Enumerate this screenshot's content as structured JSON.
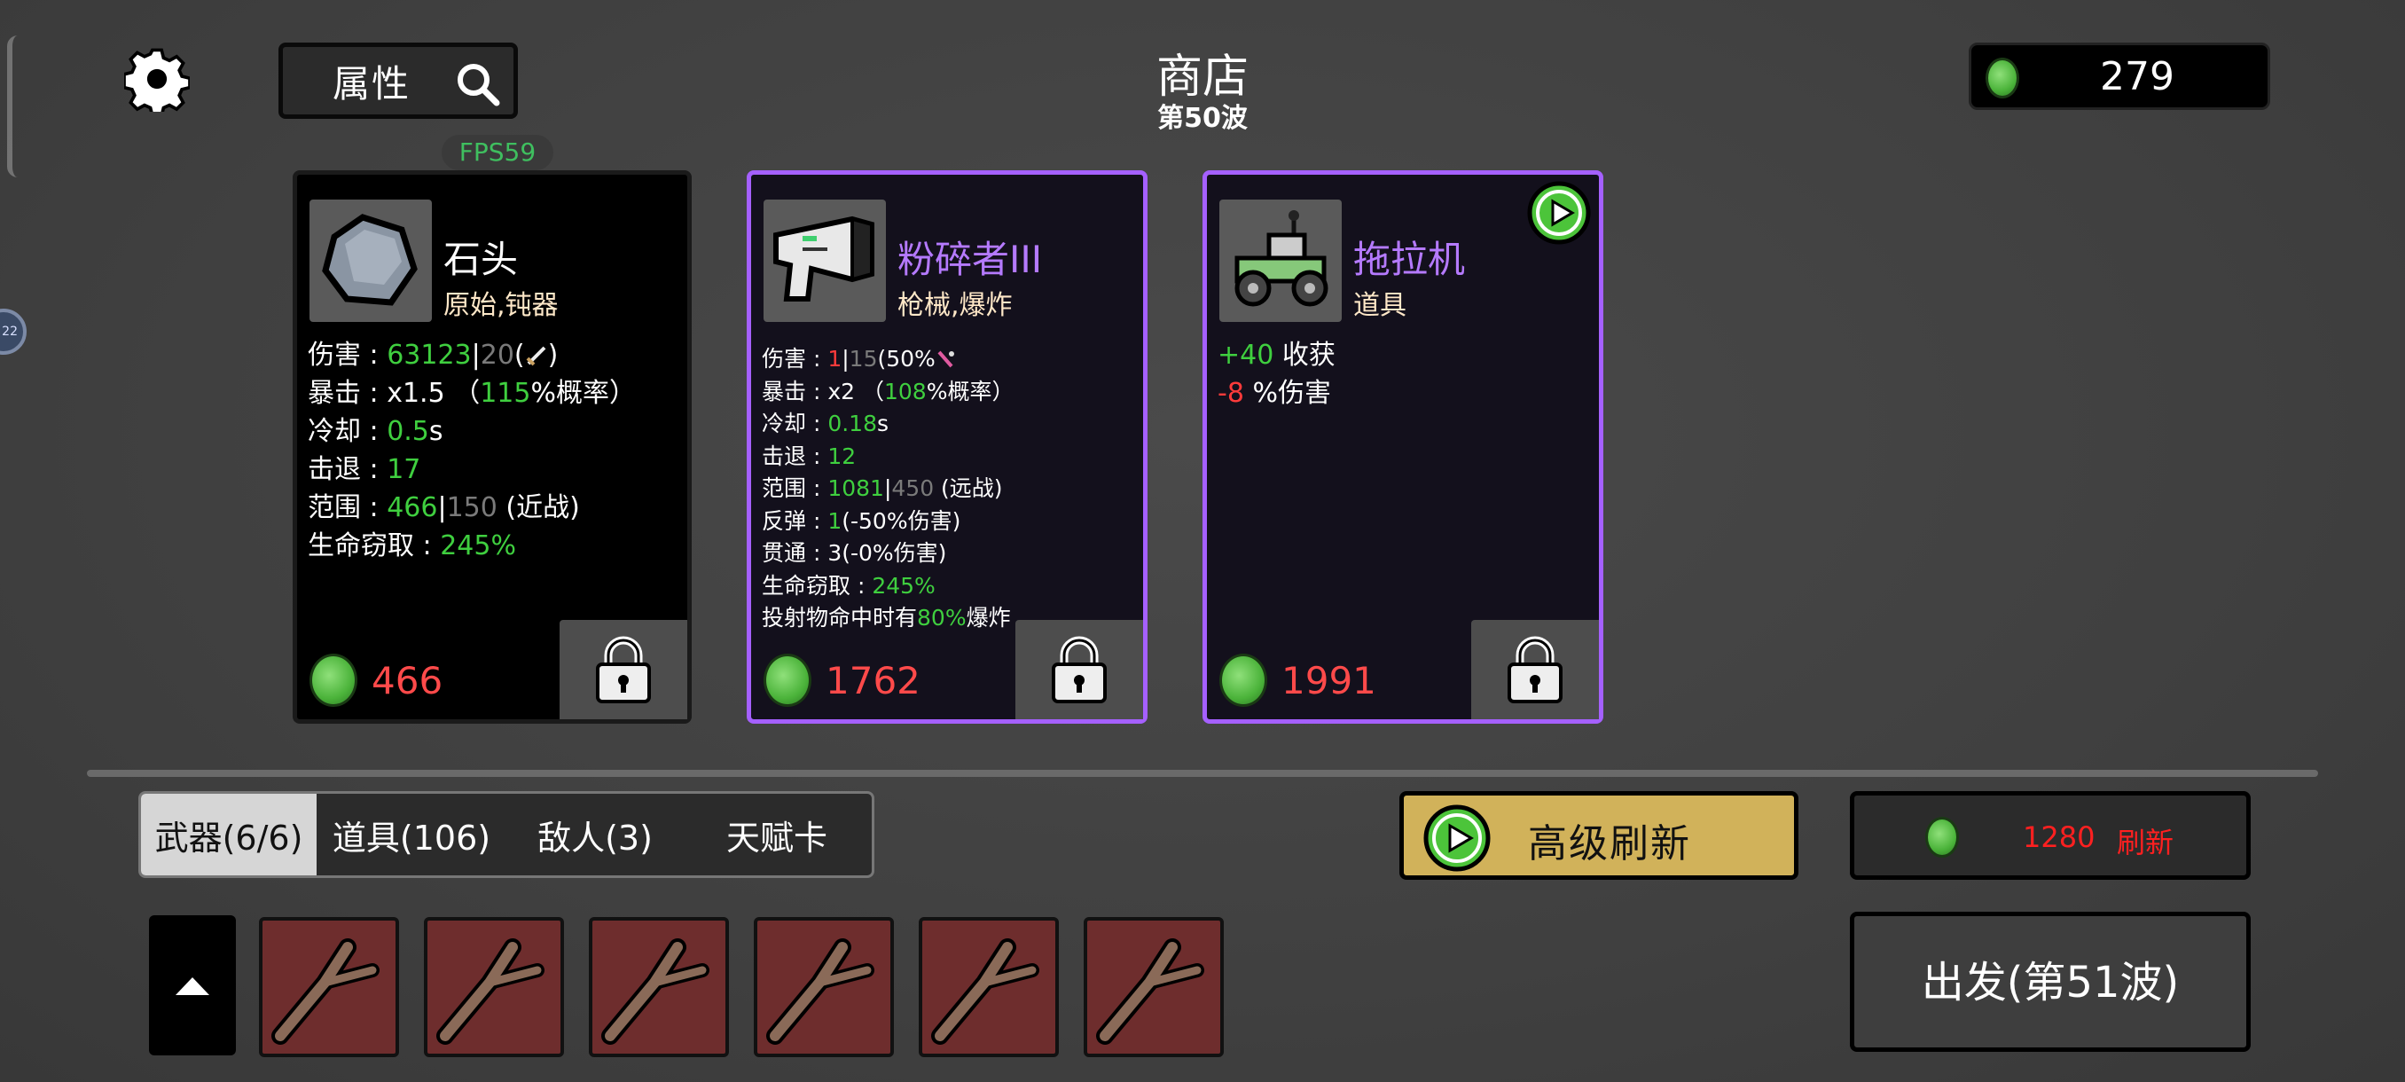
{
  "header": {
    "shop_title": "商店",
    "wave_label": "第50波",
    "attributes_label": "属性",
    "fps": "FPS59",
    "coins": "279",
    "edge_badge": "22"
  },
  "shop": [
    {
      "name": "石头",
      "tags": "原始,钝器",
      "price": "466",
      "icon": "rock-icon",
      "name_color": "#ffffff",
      "stats": {
        "damage_label": "伤害 : ",
        "damage": "63123",
        "damage_sep": "|",
        "damage_base": "20",
        "damage_open": "(",
        "damage_close": ")",
        "crit_label": "暴击 : ",
        "crit_mult": " x1.5 （",
        "crit_chance": "115",
        "crit_unit": "%概率）",
        "cooldown_label": "冷却 : ",
        "cooldown": "0.5",
        "cooldown_unit": "s",
        "knockback_label": "击退 : ",
        "knockback": "17",
        "range_label": "范围 : ",
        "range": "466",
        "range_sep": "|",
        "range_base": "150",
        "range_type": " (近战)",
        "lifesteal_label": "生命窃取 : ",
        "lifesteal": "245%"
      }
    },
    {
      "name": "粉碎者III",
      "tags": "枪械,爆炸",
      "price": "1762",
      "icon": "blaster-gun-icon",
      "name_color": "#b57aff",
      "stats": {
        "damage_label": "伤害 : ",
        "damage": "1",
        "damage_sep": "|",
        "damage_base": "15",
        "damage_extra": "(50%",
        "crit_label": "暴击 : ",
        "crit_mult": " x2 （",
        "crit_chance": "108",
        "crit_unit": "%概率）",
        "cooldown_label": "冷却 : ",
        "cooldown": "0.18",
        "cooldown_unit": "s",
        "knockback_label": "击退 : ",
        "knockback": "12",
        "range_label": "范围 : ",
        "range": "1081",
        "range_sep": "|",
        "range_base": "450",
        "range_type": " (远战)",
        "bounce_label": "反弹 : ",
        "bounce": "1",
        "bounce_unit": "(-50%伤害)",
        "pierce_label": "贯通 : ",
        "pierce": "3(-0%伤害)",
        "lifesteal_label": "生命窃取 : ",
        "lifesteal": "245%",
        "explode_pre": "投射物命中时有",
        "explode_pct": "80%",
        "explode_post": "爆炸"
      }
    },
    {
      "name": "拖拉机",
      "tags": "道具",
      "price": "1991",
      "icon": "tractor-icon",
      "name_color": "#b57aff",
      "stats": {
        "harvest_value": "+40",
        "harvest_label": " 收获",
        "damage_value": "-8",
        "damage_label": " %伤害"
      }
    }
  ],
  "tabs": [
    {
      "label": "武器(6/6)",
      "active": true
    },
    {
      "label": "道具(106)",
      "active": false
    },
    {
      "label": "敌人(3)",
      "active": false
    },
    {
      "label": "天赋卡",
      "active": false
    }
  ],
  "advanced_refresh_label": "高级刷新",
  "refresh": {
    "cost": "1280",
    "label": "刷新"
  },
  "inventory": {
    "slot_icon": "branch-icon",
    "count": 6
  },
  "depart_label": "出发(第51波)",
  "colors": {
    "positive": "#3fcf3f",
    "negative": "#ff3b3b",
    "rare_border": "#a560ff",
    "gold_button": "#d1b25a",
    "slot_bg": "#6e2d2d"
  }
}
